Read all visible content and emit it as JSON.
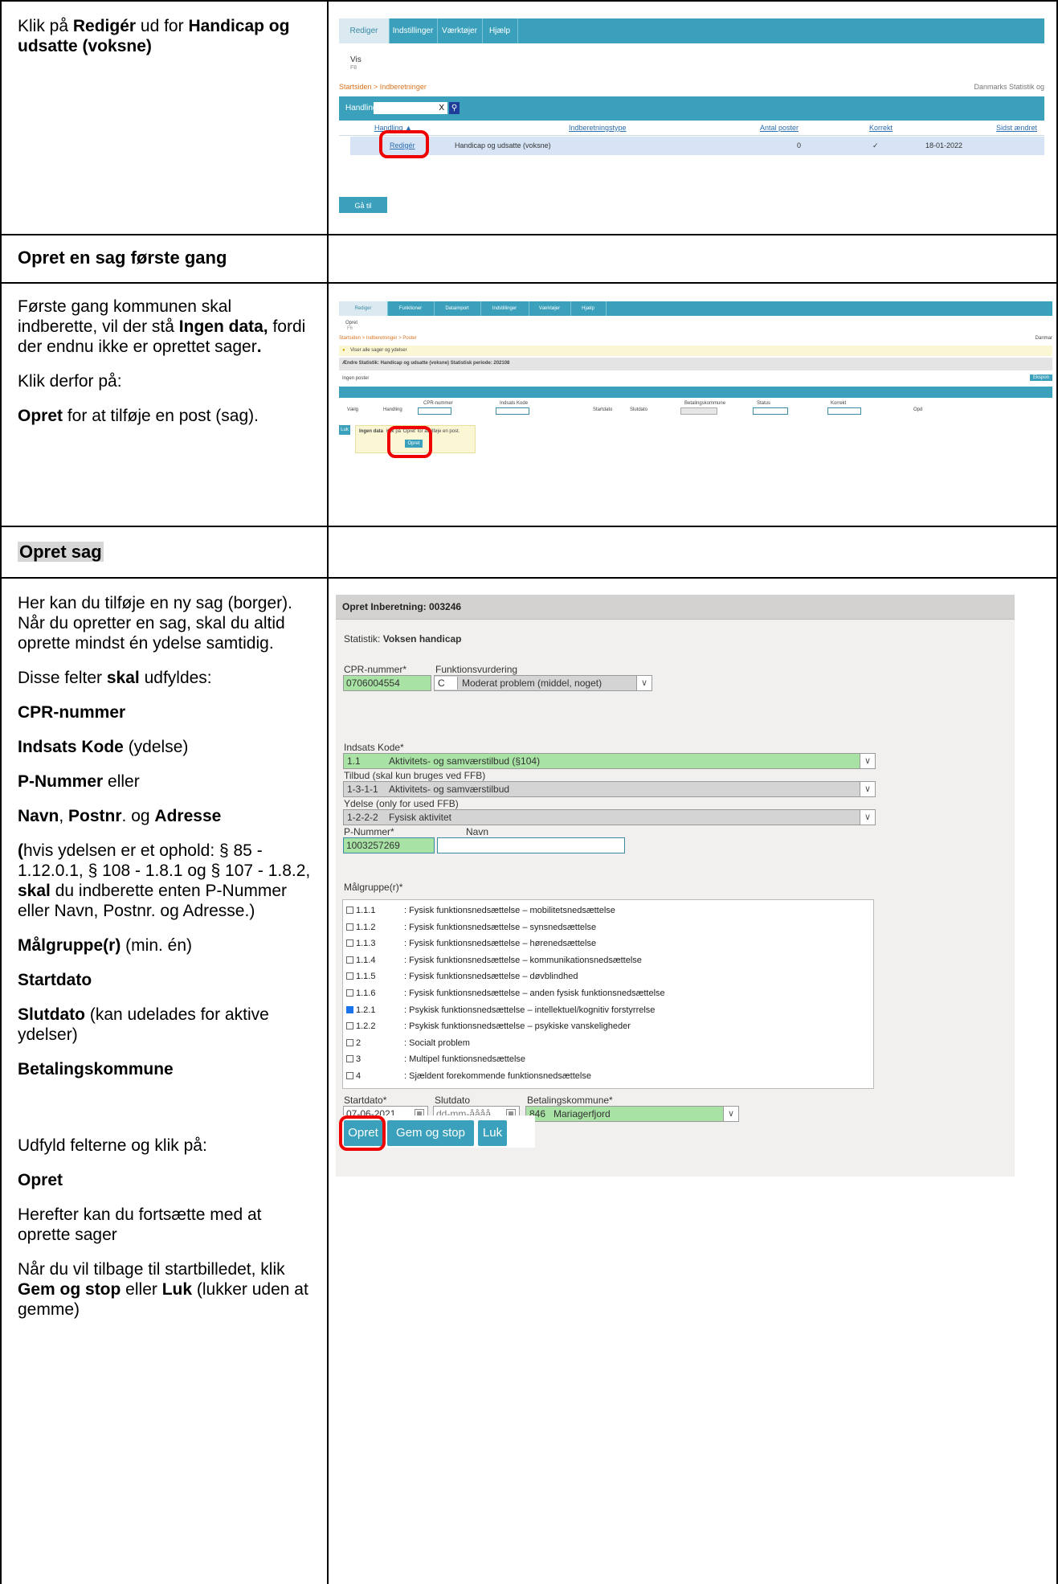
{
  "rows": {
    "r1": {
      "paragraphs": [
        [
          {
            "t": "Klik på "
          },
          {
            "t": "Redigér",
            "b": true
          },
          {
            "t": " ud for "
          },
          {
            "t": "Handicap og udsatte (voksne)",
            "b": true
          }
        ]
      ]
    },
    "h1": "Opret en sag første gang",
    "r2": {
      "paragraphs": [
        [
          {
            "t": "Første gang kommunen skal indberette, vil der stå "
          },
          {
            "t": "Ingen data,",
            "b": true
          },
          {
            "t": " fordi der endnu ikke er oprettet sager"
          },
          {
            "t": ".",
            "b": true
          }
        ],
        [
          {
            "t": "Klik derfor på:"
          }
        ],
        [
          {
            "t": "Opret",
            "b": true
          },
          {
            "t": " for at tilføje en post (sag)."
          }
        ]
      ]
    },
    "h2": "Opret sag",
    "r3": {
      "paragraphs": [
        [
          {
            "t": "Her kan du tilføje en ny sag (borger). Når du opretter en sag, skal du altid oprette mindst én ydelse samtidig."
          }
        ],
        [
          {
            "t": "Disse felter "
          },
          {
            "t": "skal",
            "b": true
          },
          {
            "t": " udfyldes:"
          }
        ],
        [
          {
            "t": "CPR-nummer",
            "b": true
          }
        ],
        [
          {
            "t": "Indsats Kode",
            "b": true
          },
          {
            "t": " (ydelse)"
          }
        ],
        [
          {
            "t": "P-Nummer",
            "b": true
          },
          {
            "t": " eller"
          }
        ],
        [
          {
            "t": "Navn",
            "b": true
          },
          {
            "t": ", "
          },
          {
            "t": "Postnr",
            "b": true
          },
          {
            "t": ". og "
          },
          {
            "t": "Adresse",
            "b": true
          }
        ],
        [
          {
            "t": "(",
            "b": true
          },
          {
            "t": "hvis ydelsen er et ophold: § 85 - 1.12.0.1, § 108 - 1.8.1 og § 107 - 1.8.2, "
          },
          {
            "t": "skal",
            "b": true
          },
          {
            "t": " du indberette enten P-Nummer eller Navn, Postnr. og Adresse.)"
          }
        ],
        [
          {
            "t": "Målgruppe(r)",
            "b": true
          },
          {
            "t": " (min. én)"
          }
        ],
        [
          {
            "t": "Startdato",
            "b": true
          }
        ],
        [
          {
            "t": "Slutdato",
            "b": true
          },
          {
            "t": " (kan udelades for aktive ydelser)"
          }
        ],
        [
          {
            "t": "Betalingskommune",
            "b": true
          }
        ],
        [
          {
            "t": ""
          }
        ],
        [
          {
            "t": "Udfyld felterne og klik på:"
          }
        ],
        [
          {
            "t": "Opret",
            "b": true
          }
        ],
        [
          {
            "t": "Herefter kan du fortsætte med at oprette sager"
          }
        ],
        [
          {
            "t": "Når du vil tilbage til startbilledet, klik "
          },
          {
            "t": "Gem og stop",
            "b": true
          },
          {
            "t": " eller "
          },
          {
            "t": "Luk",
            "b": true
          },
          {
            "t": " (lukker uden at gemme)"
          }
        ]
      ]
    }
  },
  "shot1": {
    "tabs": [
      "Rediger",
      "Indstillinger",
      "Værktøjer",
      "Hjælp"
    ],
    "vis": "Vis",
    "vis_sub": "F8",
    "breadcrumb": "Startsiden > Indberetninger",
    "right_text": "Danmarks Statistik og",
    "filter_label": "Handling:",
    "filter_clear": "X",
    "columns": [
      "Handling ▲",
      "Indberetningstype",
      "Antal poster",
      "Korrekt",
      "Sidst ændret"
    ],
    "row": {
      "action": "Redigér",
      "type": "Handicap og udsatte (voksne)",
      "count": "0",
      "correct": "✓",
      "changed": "18-01-2022"
    },
    "home_button": "Gå til startsiden"
  },
  "shot2": {
    "tabs": [
      "Rediger",
      "Funktioner",
      "Dataimport",
      "Indstillinger",
      "Værktøjer",
      "Hjælp"
    ],
    "opret": "Opret",
    "opret_sub": "F6",
    "breadcrumb": "Startsiden > Indberetninger > Poster",
    "right_text": "Danmar",
    "info": "Viser alle sager og ydelser",
    "header": "Ændre  Statistik: Handicap og udsatte (voksne)  Statistisk periode: 202108",
    "no_posts": "Ingen poster",
    "export": "Ekspon",
    "columns": [
      "Vælg",
      "Handling",
      "CPR-nummer",
      "Indsats Kode",
      "Startdato",
      "Slutdato",
      "Betalingskommune",
      "Status",
      "Korrekt",
      "Opd"
    ],
    "close_button": "Luk",
    "popup_bold": "Ingen data",
    "popup_text": "Klik på 'Opret' for at tilføje en post.",
    "popup_button": "Opret"
  },
  "shot3": {
    "title": "Opret Inberetning: 003246",
    "stat_label": "Statistik:",
    "stat_value": "Voksen handicap",
    "cpr_label": "CPR-nummer*",
    "cpr_value": "0706004554",
    "fv_label": "Funktionsvurdering",
    "fv_code": "C",
    "fv_text": "Moderat problem (middel, noget)",
    "ik_label": "Indsats Kode*",
    "ik_code": "1.1",
    "ik_text": "Aktivitets- og samværstilbud (§104)",
    "tb_label": "Tilbud (skal kun bruges ved FFB)",
    "tb_code": "1-3-1-1",
    "tb_text": "Aktivitets- og samværstilbud",
    "yd_label": "Ydelse (only for used FFB)",
    "yd_code": "1-2-2-2",
    "yd_text": "Fysisk aktivitet",
    "pn_label": "P-Nummer*",
    "pn_value": "1003257269",
    "navn_label": "Navn",
    "mg_label": "Målgruppe(r)*",
    "malgrupper": [
      {
        "code": "1.1.1",
        "text": ": Fysisk funktionsnedsættelse – mobilitetsnedsættelse",
        "checked": false
      },
      {
        "code": "1.1.2",
        "text": ": Fysisk funktionsnedsættelse – synsnedsættelse",
        "checked": false
      },
      {
        "code": "1.1.3",
        "text": ": Fysisk funktionsnedsættelse – hørenedsættelse",
        "checked": false
      },
      {
        "code": "1.1.4",
        "text": ": Fysisk funktionsnedsættelse – kommunikationsnedsættelse",
        "checked": false
      },
      {
        "code": "1.1.5",
        "text": ": Fysisk funktionsnedsættelse – døvblindhed",
        "checked": false
      },
      {
        "code": "1.1.6",
        "text": ": Fysisk funktionsnedsættelse – anden fysisk funktionsnedsættelse",
        "checked": false
      },
      {
        "code": "1.2.1",
        "text": ": Psykisk funktionsnedsættelse – intellektuel/kognitiv forstyrrelse",
        "checked": true
      },
      {
        "code": "1.2.2",
        "text": ": Psykisk funktionsnedsættelse – psykiske vanskeligheder",
        "checked": false
      },
      {
        "code": "2",
        "text": ": Socialt problem",
        "checked": false
      },
      {
        "code": "3",
        "text": ": Multipel funktionsnedsættelse",
        "checked": false
      },
      {
        "code": "4",
        "text": ": Sjældent forekommende funktionsnedsættelse",
        "checked": false
      }
    ],
    "start_label": "Startdato*",
    "start_value": "07-06-2021",
    "slut_label": "Slutdato",
    "slut_placeholder": "dd-mm-åååå",
    "bk_label": "Betalingskommune*",
    "bk_code": "846",
    "bk_text": "Mariagerfjord",
    "buttons": [
      "Opret",
      "Gem og stop",
      "Luk"
    ]
  }
}
